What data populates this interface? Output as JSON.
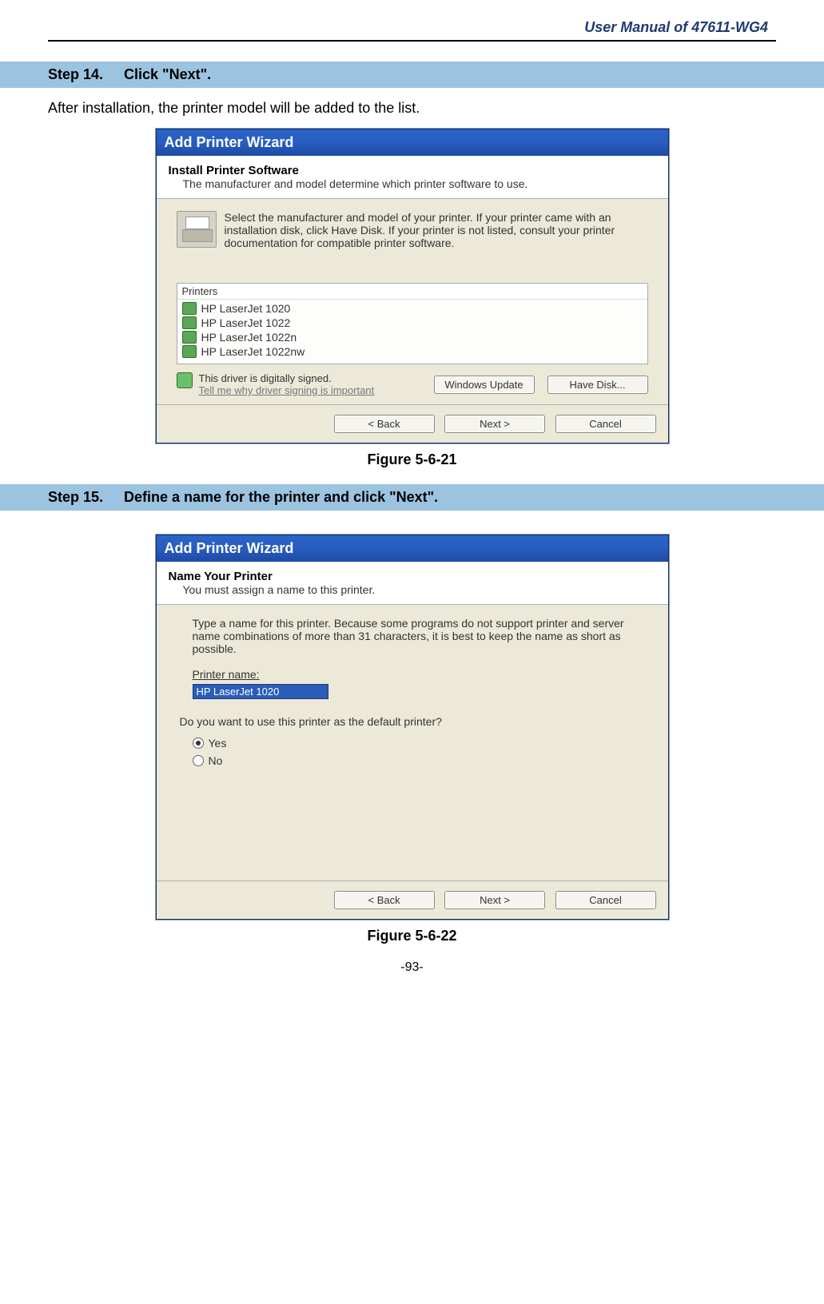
{
  "doc": {
    "header": "User Manual of 47611-WG4",
    "page_number": "-93-"
  },
  "step14": {
    "num": "Step 14.",
    "title": "Click \"Next\".",
    "after_text": "After installation, the printer model will be added to the list.",
    "figure_caption": "Figure 5-6-21"
  },
  "wiz1": {
    "titlebar": "Add Printer Wizard",
    "header_title": "Install Printer Software",
    "header_sub": "The manufacturer and model determine which printer software to use.",
    "instruction": "Select the manufacturer and model of your printer. If your printer came with an installation disk, click Have Disk. If your printer is not listed, consult your printer documentation for compatible printer software.",
    "panel_header": "Printers",
    "printers": [
      "HP LaserJet 1020",
      "HP LaserJet 1022",
      "HP LaserJet 1022n",
      "HP LaserJet 1022nw"
    ],
    "signed_text": "This driver is digitally signed.",
    "tell_me": "Tell me why driver signing is important",
    "btn_windows_update": "Windows Update",
    "btn_have_disk": "Have Disk...",
    "btn_back": "< Back",
    "btn_next": "Next >",
    "btn_cancel": "Cancel"
  },
  "step15": {
    "num": "Step 15.",
    "title": "Define a name for the printer and click \"Next\".",
    "figure_caption": "Figure 5-6-22"
  },
  "wiz2": {
    "titlebar": "Add Printer Wizard",
    "header_title": "Name Your Printer",
    "header_sub": "You must assign a name to this printer.",
    "instruction": "Type a name for this printer. Because some programs do not support printer and server name combinations of more than 31 characters, it is best to keep the name as short as possible.",
    "field_label": "Printer name:",
    "field_value": "HP LaserJet 1020",
    "default_question": "Do you want to use this printer as the default printer?",
    "radio_yes": "Yes",
    "radio_no": "No",
    "btn_back": "< Back",
    "btn_next": "Next >",
    "btn_cancel": "Cancel"
  }
}
